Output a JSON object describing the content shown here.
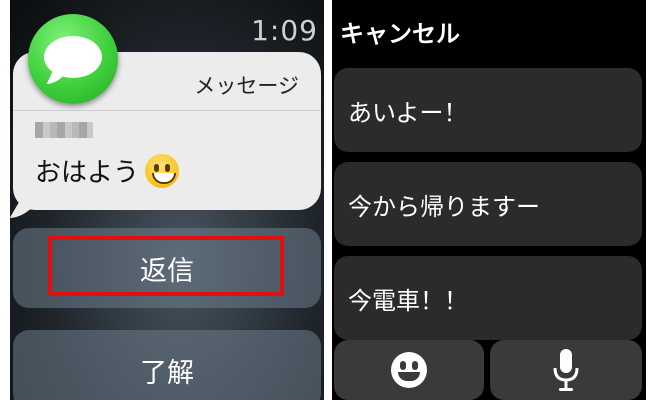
{
  "left_screen": {
    "time": "1:09",
    "notification": {
      "app_name": "メッセージ",
      "message": "おはよう"
    },
    "actions": {
      "reply_label": "返信",
      "dismiss_label": "了解"
    },
    "highlight_color": "#e01010"
  },
  "right_screen": {
    "cancel_label": "キャンセル",
    "quick_replies": [
      "あいよー！",
      "今から帰りますー",
      "今電車！！"
    ],
    "icons": {
      "emoji": "emoji-icon",
      "dictation": "microphone-icon"
    }
  }
}
